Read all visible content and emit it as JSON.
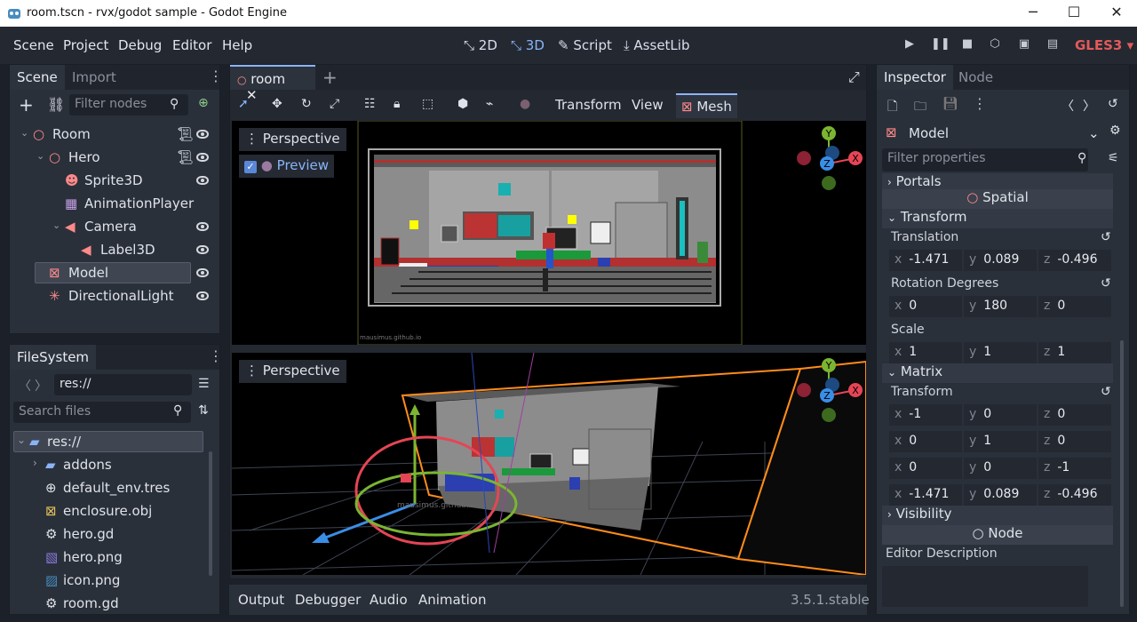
{
  "window": {
    "title": "room.tscn - rvx/godot sample - Godot Engine",
    "minimize": "─",
    "maximize": "☐",
    "close": "✕"
  },
  "menu": [
    "Scene",
    "Project",
    "Debug",
    "Editor",
    "Help"
  ],
  "modes": {
    "m2d": "2D",
    "m3d": "3D",
    "script": "Script",
    "assetlib": "AssetLib"
  },
  "renderer": "GLES3",
  "scene_panel": {
    "tabs": [
      "Scene",
      "Import"
    ],
    "filter_placeholder": "Filter nodes",
    "nodes": [
      {
        "label": "Room",
        "depth": 0,
        "script": true,
        "eye": true
      },
      {
        "label": "Hero",
        "depth": 1,
        "script": true,
        "eye": true
      },
      {
        "label": "Sprite3D",
        "depth": 2,
        "script": false,
        "eye": true
      },
      {
        "label": "AnimationPlayer",
        "depth": 2,
        "script": false,
        "eye": false
      },
      {
        "label": "Camera",
        "depth": 2,
        "script": false,
        "eye": true
      },
      {
        "label": "Label3D",
        "depth": 3,
        "script": false,
        "eye": true
      },
      {
        "label": "Model",
        "depth": 1,
        "script": false,
        "eye": true,
        "selected": true
      },
      {
        "label": "DirectionalLight",
        "depth": 1,
        "script": false,
        "eye": true
      }
    ]
  },
  "filesystem": {
    "title": "FileSystem",
    "path": "res://",
    "search_placeholder": "Search files",
    "items": [
      "res://",
      "addons",
      "default_env.tres",
      "enclosure.obj",
      "hero.gd",
      "hero.png",
      "icon.png",
      "room.gd"
    ]
  },
  "editor": {
    "tab": "room",
    "toolbar": {
      "transform": "Transform",
      "view": "View",
      "mesh": "Mesh"
    },
    "vp_top": {
      "label": "Perspective",
      "preview": "Preview",
      "watermark": "mausimus.github.io"
    },
    "vp_bottom": {
      "label": "Perspective",
      "watermark": "mausimus.github.io"
    }
  },
  "bottom": {
    "tabs": [
      "Output",
      "Debugger",
      "Audio",
      "Animation"
    ],
    "version": "3.5.1.stable"
  },
  "inspector": {
    "tabs": [
      "Inspector",
      "Node"
    ],
    "object": "Model",
    "filter_placeholder": "Filter properties",
    "portals": "Portals",
    "spatial": "Spatial",
    "transform_section": "Transform",
    "translation_label": "Translation",
    "translation": {
      "x": "-1.471",
      "y": "0.089",
      "z": "-0.496"
    },
    "rotation_label": "Rotation Degrees",
    "rotation": {
      "x": "0",
      "y": "180",
      "z": "0"
    },
    "scale_label": "Scale",
    "scale": {
      "x": "1",
      "y": "1",
      "z": "1"
    },
    "matrix_section": "Matrix",
    "matrix_label": "Transform",
    "matrix": [
      {
        "x": "-1",
        "y": "0",
        "z": "0"
      },
      {
        "x": "0",
        "y": "1",
        "z": "0"
      },
      {
        "x": "0",
        "y": "0",
        "z": "-1"
      },
      {
        "x": "-1.471",
        "y": "0.089",
        "z": "-0.496"
      }
    ],
    "visibility": "Visibility",
    "node_section": "Node",
    "editor_description": "Editor Description"
  },
  "axis_labels": {
    "x": "X",
    "y": "Y",
    "z": "Z"
  },
  "colors": {
    "accent": "#8ab4f8",
    "axis_x": "#e64555",
    "axis_y": "#7bb531",
    "axis_z": "#3a8ee6",
    "renderer": "#e25a5a"
  }
}
